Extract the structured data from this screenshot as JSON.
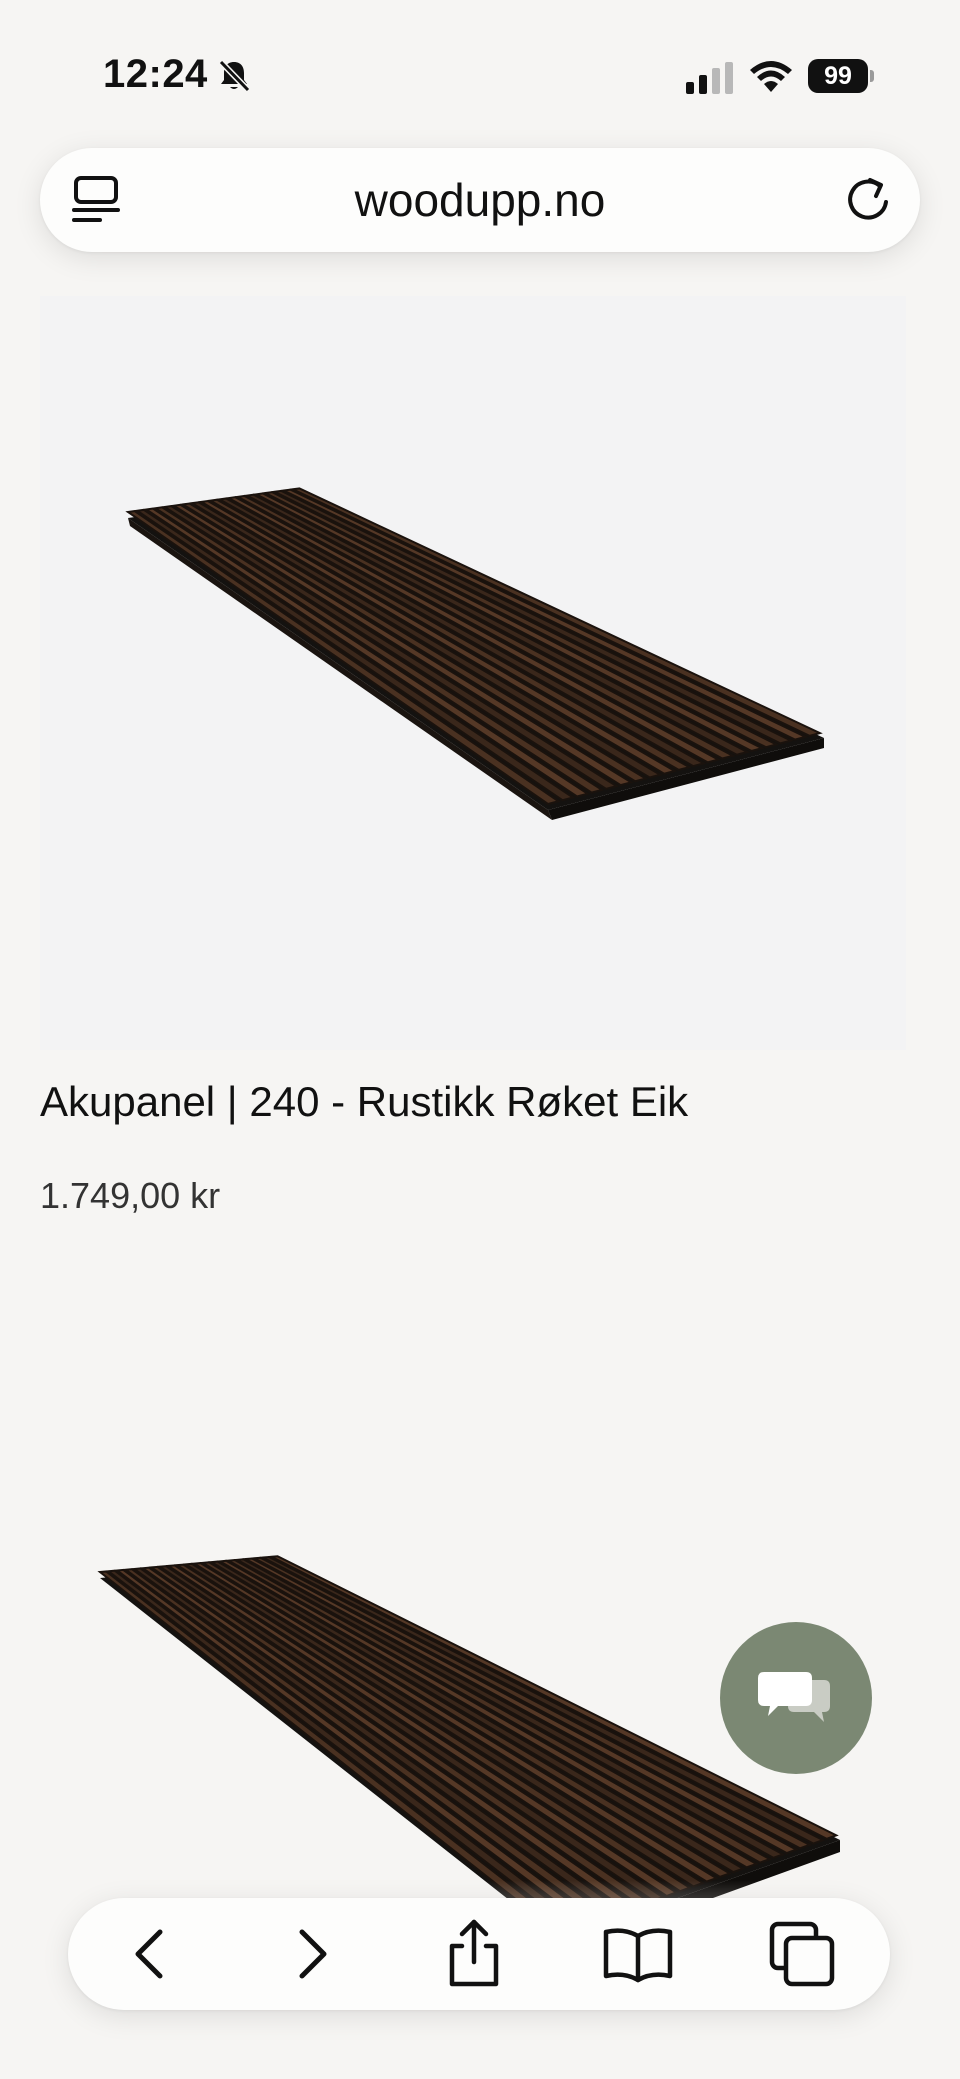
{
  "status_bar": {
    "time": "12:24",
    "battery_level": "99",
    "icons": [
      "silent-bell-icon",
      "cellular-signal-icon",
      "wifi-icon",
      "battery-icon"
    ]
  },
  "address_bar": {
    "url": "woodupp.no",
    "icons": [
      "reader-view-icon",
      "reload-icon"
    ]
  },
  "product": {
    "title": "Akupanel | 240 - Rustikk Røket Eik",
    "price": "1.749,00 kr"
  },
  "chat": {
    "icon": "chat-bubbles-icon",
    "color": "#7b8873"
  },
  "toolbar": {
    "icons": [
      "back-icon",
      "forward-icon",
      "share-icon",
      "bookmarks-icon",
      "tabs-icon"
    ]
  },
  "colors": {
    "page_background": "#f6f5f3",
    "panel_wood_dark": "#2b2019",
    "panel_wood_light": "#5a3a26"
  }
}
